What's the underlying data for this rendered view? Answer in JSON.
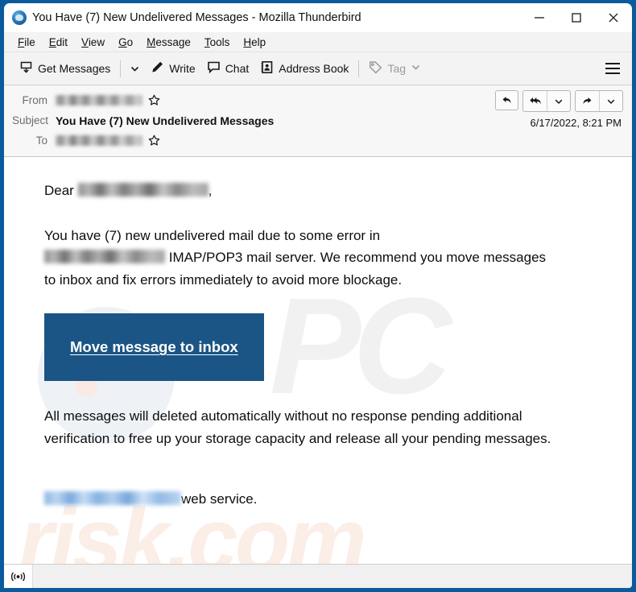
{
  "window": {
    "title": "You Have (7) New Undelivered Messages - Mozilla Thunderbird",
    "app_icon": "thunderbird-icon",
    "controls": {
      "minimize": "minimize-icon",
      "maximize": "maximize-icon",
      "close": "close-icon"
    },
    "accent_color": "#0c5a9e"
  },
  "menubar": {
    "items": [
      {
        "label": "File",
        "accesskey": "F",
        "rest": "ile"
      },
      {
        "label": "Edit",
        "accesskey": "E",
        "rest": "dit"
      },
      {
        "label": "View",
        "accesskey": "V",
        "rest": "iew"
      },
      {
        "label": "Go",
        "accesskey": "G",
        "rest": "o"
      },
      {
        "label": "Message",
        "accesskey": "M",
        "rest": "essage"
      },
      {
        "label": "Tools",
        "accesskey": "T",
        "rest": "ools"
      },
      {
        "label": "Help",
        "accesskey": "H",
        "rest": "elp"
      }
    ]
  },
  "toolbar": {
    "get_messages": "Get Messages",
    "get_messages_icon": "get-messages-icon",
    "get_messages_dropdown": "chevron-down-icon",
    "write": "Write",
    "write_icon": "pencil-icon",
    "chat": "Chat",
    "chat_icon": "chat-bubble-icon",
    "address_book": "Address Book",
    "address_book_icon": "address-book-icon",
    "tag": "Tag",
    "tag_icon": "tag-icon",
    "tag_dropdown": "chevron-down-icon",
    "tag_disabled": true,
    "app_menu_icon": "hamburger-icon"
  },
  "message_header": {
    "from_label": "From",
    "from_value": "",
    "from_redacted": true,
    "subject_label": "Subject",
    "subject_value": "You Have (7) New Undelivered Messages",
    "to_label": "To",
    "to_value": "",
    "to_redacted": true,
    "date": "6/17/2022, 8:21 PM",
    "star_icon": "star-icon",
    "actions": [
      {
        "name": "reply-button",
        "icon": "reply-icon"
      },
      {
        "name": "reply-all-button",
        "icon": "reply-all-icon"
      },
      {
        "name": "reply-all-dropdown",
        "icon": "chevron-down-icon"
      },
      {
        "name": "forward-button",
        "icon": "forward-icon"
      },
      {
        "name": "more-actions-dropdown",
        "icon": "chevron-down-icon"
      }
    ]
  },
  "email_body": {
    "greeting_prefix": "Dear ",
    "greeting_suffix": ",",
    "paragraph1_part1": "You have (7) new undelivered mail due to some error in",
    "paragraph1_part2": "IMAP/POP3 mail server. We recommend you move messages to inbox and fix errors immediately to avoid more blockage.",
    "cta_label": "Move message to inbox",
    "cta_color": "#1a5585",
    "paragraph2": "All messages will deleted automatically without no response pending additional verification to free up your storage capacity and release all your pending messages.",
    "footer_suffix": "web service.",
    "watermark_text": "PC",
    "watermark_text2": "risk.com"
  },
  "statusbar": {
    "connection_icon": "broadcast-icon",
    "text": ""
  }
}
